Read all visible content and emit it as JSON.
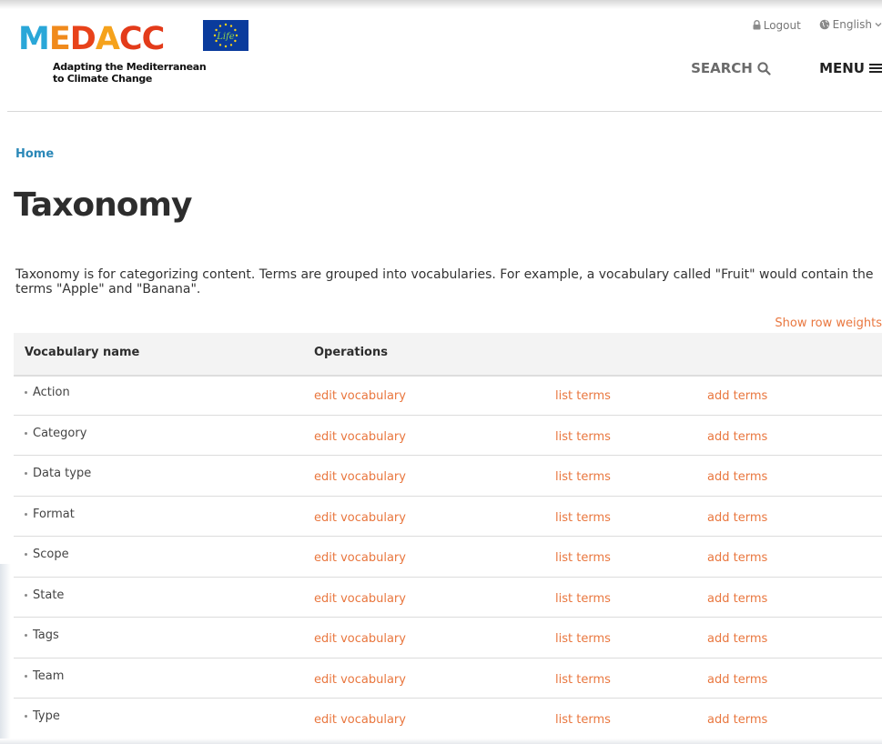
{
  "header": {
    "logo_text_parts": [
      "M",
      "E",
      "D",
      "A",
      "CC"
    ],
    "logo_tagline_line1": "Adapting the Mediterranean",
    "logo_tagline_line2": "to Climate Change",
    "eu_label": "Life",
    "logout_label": "Logout",
    "language_label": "English",
    "search_label": "SEARCH",
    "menu_label": "MENU"
  },
  "breadcrumb": {
    "home_label": "Home"
  },
  "page": {
    "title": "Taxonomy",
    "description": "Taxonomy is for categorizing content. Terms are grouped into vocabularies. For example, a vocabulary called \"Fruit\" would contain the terms \"Apple\" and \"Banana\".",
    "show_row_weights_label": "Show row weights"
  },
  "table": {
    "headers": {
      "name": "Vocabulary name",
      "operations": "Operations"
    },
    "op_labels": {
      "edit": "edit vocabulary",
      "list": "list terms",
      "add": "add terms"
    },
    "rows": [
      {
        "name": "Action"
      },
      {
        "name": "Category"
      },
      {
        "name": "Data type"
      },
      {
        "name": "Format"
      },
      {
        "name": "Scope"
      },
      {
        "name": "State"
      },
      {
        "name": "Tags"
      },
      {
        "name": "Team"
      },
      {
        "name": "Type"
      }
    ]
  },
  "colors": {
    "link_orange": "#e9773f",
    "breadcrumb_blue": "#2b88b8",
    "logo_blue": "#2aa7d8",
    "logo_orange": "#f08a1c",
    "logo_red": "#e8421a",
    "eu_blue": "#0a3b9c"
  },
  "icons": {
    "logout": "lock-icon",
    "language": "globe-icon",
    "language_caret": "caret-down-icon",
    "search": "search-icon",
    "menu": "hamburger-icon",
    "row_handle": "drag-handle-icon"
  }
}
